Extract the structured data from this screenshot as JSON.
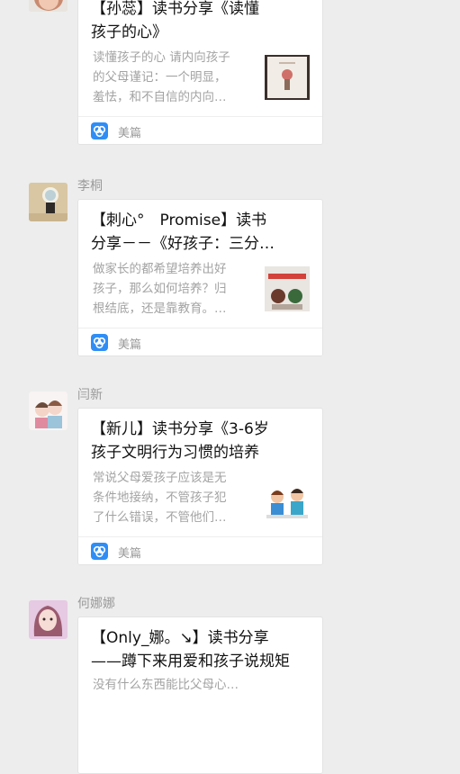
{
  "messages": [
    {
      "sender": "",
      "title": "【孙蕊】读书分享《读懂孩子的心》",
      "title_display": "【孙蕊】读书分享《读懂\n孩子的心》",
      "desc": "读懂孩子的心 请内向孩子\n的父母谨记：一个明显，\n羞怯，和不自信的内向…",
      "app": "美篇"
    },
    {
      "sender": "李桐",
      "title": "【刺心°　Promise】读书分享－－《好孩子：三分…",
      "title_display": "【刺心°　Promise】读书\n分享－－《好孩子：三分…",
      "desc": "做家长的都希望培养出好\n孩子，那么如何培养？归\n根结底，还是靠教育。…",
      "app": "美篇"
    },
    {
      "sender": "闫新",
      "title": "【新儿】读书分享《3-6岁孩子文明行为习惯的培养",
      "title_display": "【新儿】读书分享《3-6岁\n孩子文明行为习惯的培养",
      "desc": "常说父母爱孩子应该是无\n条件地接纳，不管孩子犯\n了什么错误，不管他们…",
      "app": "美篇"
    },
    {
      "sender": "何娜娜",
      "title": "【Only_娜。↘】读书分享——蹲下来用爱和孩子说规矩",
      "title_display": "【Only_娜。↘】读书分享\n——蹲下来用爱和孩子说规矩",
      "desc": "没有什么东西能比父母心…",
      "app": ""
    }
  ]
}
